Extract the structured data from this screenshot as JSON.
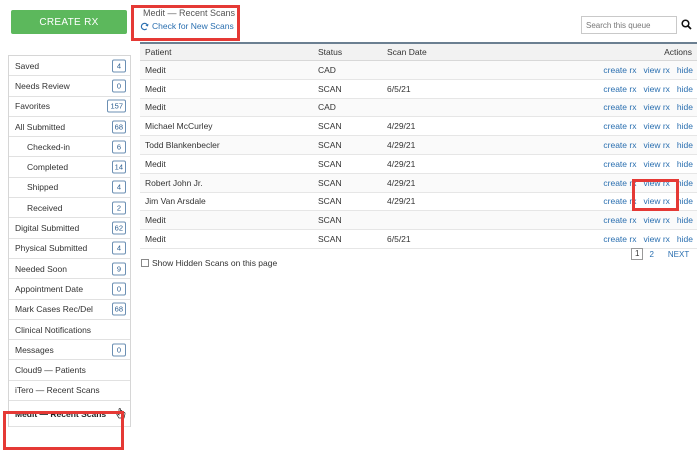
{
  "sidebar": {
    "create_label": "CREATE RX",
    "items": [
      {
        "label": "Saved",
        "count": "4"
      },
      {
        "label": "Needs Review",
        "count": "0"
      },
      {
        "label": "Favorites",
        "count": "157"
      },
      {
        "label": "All Submitted",
        "count": "68"
      },
      {
        "label": "Checked-in",
        "count": "6"
      },
      {
        "label": "Completed",
        "count": "14"
      },
      {
        "label": "Shipped",
        "count": "4"
      },
      {
        "label": "Received",
        "count": "2"
      },
      {
        "label": "Digital Submitted",
        "count": "62"
      },
      {
        "label": "Physical Submitted",
        "count": "4"
      },
      {
        "label": "Needed Soon",
        "count": "9"
      },
      {
        "label": "Appointment Date",
        "count": "0"
      },
      {
        "label": "Mark Cases Rec/Del",
        "count": "68"
      },
      {
        "label": "Clinical Notifications"
      },
      {
        "label": "Messages",
        "count": "0"
      },
      {
        "label": "Cloud9 — Patients"
      },
      {
        "label": "iTero — Recent Scans"
      },
      {
        "label": "Medit — Recent Scans"
      }
    ]
  },
  "header": {
    "queue_title": "Medit — Recent Scans",
    "check_label": "Check for New Scans",
    "search_placeholder": "Search this queue"
  },
  "table": {
    "columns": {
      "patient": "Patient",
      "status": "Status",
      "date": "Scan Date",
      "actions": "Actions"
    },
    "action_labels": {
      "create": "create rx",
      "view": "view rx",
      "hide": "hide"
    },
    "rows": [
      {
        "patient": "Medit",
        "status": "CAD",
        "date": ""
      },
      {
        "patient": "Medit",
        "status": "SCAN",
        "date": "6/5/21"
      },
      {
        "patient": "Medit",
        "status": "CAD",
        "date": ""
      },
      {
        "patient": "Michael McCurley",
        "status": "SCAN",
        "date": "4/29/21"
      },
      {
        "patient": "Todd Blankenbecler",
        "status": "SCAN",
        "date": "4/29/21"
      },
      {
        "patient": "Medit",
        "status": "SCAN",
        "date": "4/29/21"
      },
      {
        "patient": "Robert John Jr.",
        "status": "SCAN",
        "date": "4/29/21"
      },
      {
        "patient": "Jim Van Arsdale",
        "status": "SCAN",
        "date": "4/29/21"
      },
      {
        "patient": "Medit",
        "status": "SCAN",
        "date": ""
      },
      {
        "patient": "Medit",
        "status": "SCAN",
        "date": "6/5/21"
      }
    ]
  },
  "footer": {
    "show_hidden_label": "Show Hidden Scans on this page",
    "pages": [
      "1",
      "2"
    ],
    "next_label": "NEXT"
  },
  "colors": {
    "accent_green": "#5cb85c",
    "link_blue": "#2a6fb0",
    "highlight_red": "#e53935"
  },
  "icons": [
    "refresh-icon",
    "search-icon",
    "hand-pointer-icon"
  ]
}
